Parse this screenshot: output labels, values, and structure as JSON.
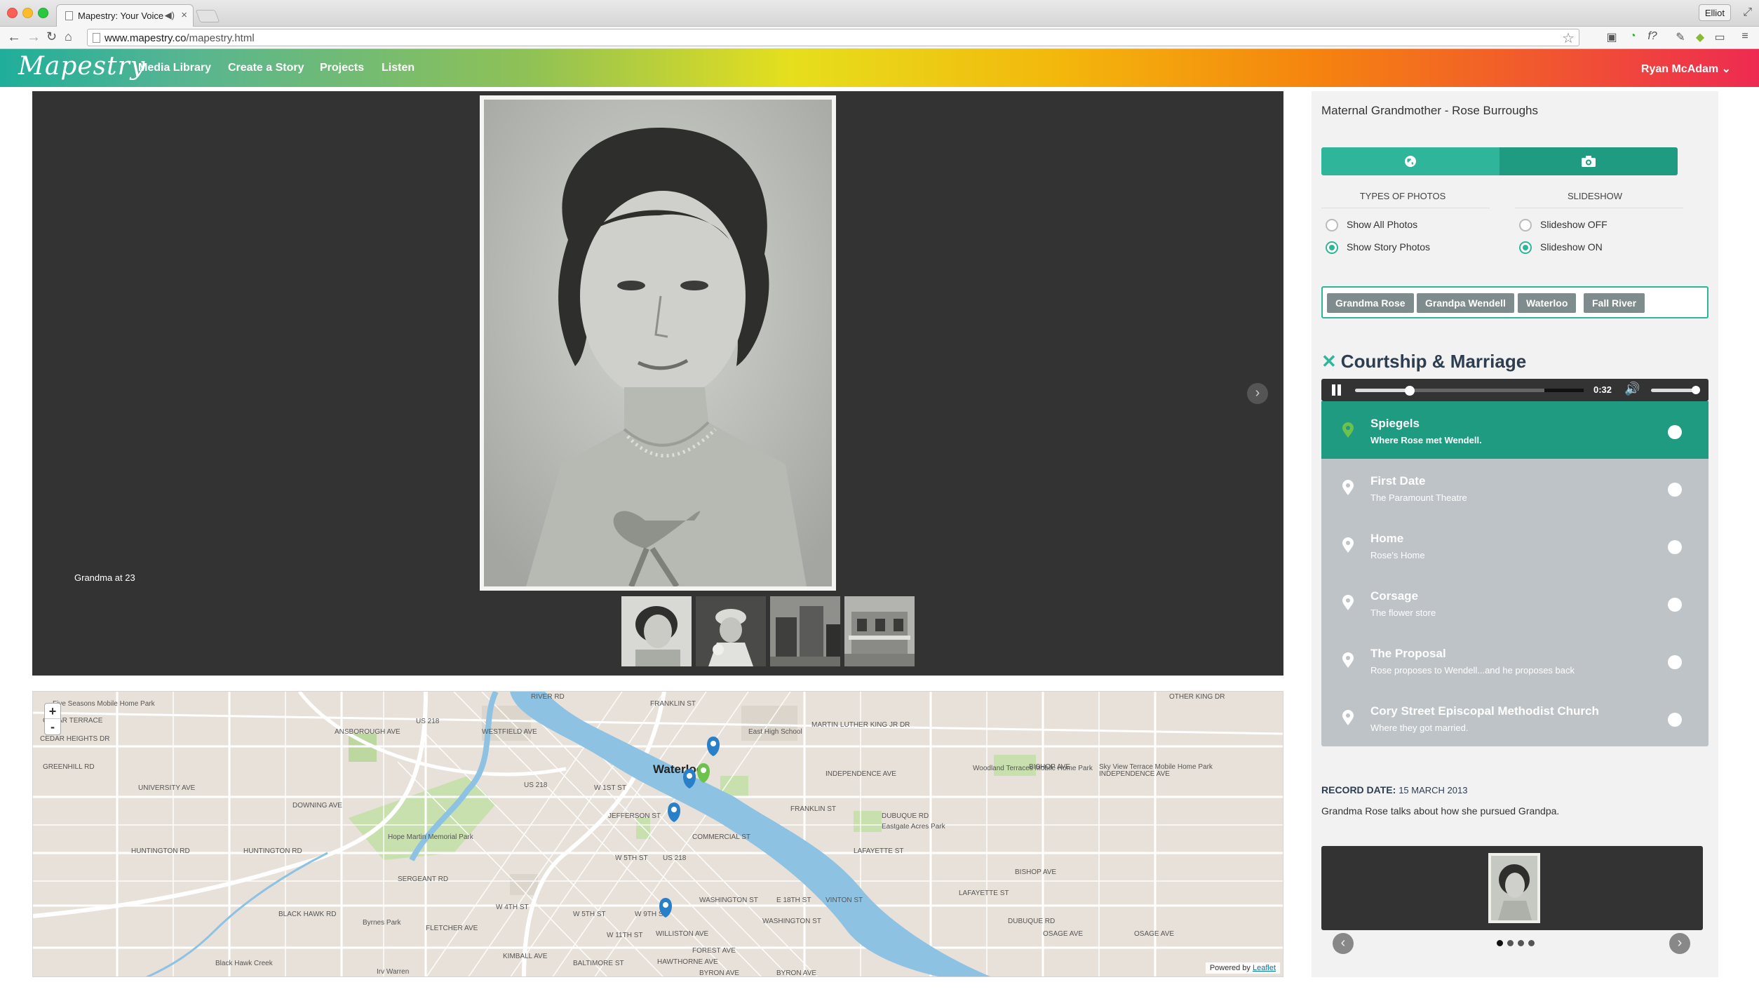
{
  "browser": {
    "tab_title": "Mapestry: Your Voice M",
    "url_host": "www.mapestry.co",
    "url_path": "/mapestry.html",
    "profile": "Elliot"
  },
  "app": {
    "logo": "Mapestry",
    "nav": [
      "Media Library",
      "Create a Story",
      "Projects",
      "Listen"
    ],
    "user": "Ryan McAdam"
  },
  "viewer": {
    "caption": "Grandma at 23",
    "thumbnails": [
      "grandma-portrait",
      "bride-portrait",
      "downtown-buildings",
      "house"
    ]
  },
  "map": {
    "zoom_in": "+",
    "zoom_out": "-",
    "attribution_prefix": "Powered by",
    "attribution_link": "Leaflet",
    "labels": {
      "city": "Waterloo",
      "east_high": "East High School",
      "us218a": "US 218",
      "us218b": "US 218",
      "us218c": "US 218",
      "martin_luther": "MARTIN LUTHER KING JR DR",
      "independence": "INDEPENDENCE AVE",
      "independence2": "INDEPENDENCE AVE",
      "franklin": "FRANKLIN ST",
      "franklin2": "FRANKLIN ST",
      "greenhill": "GREENHILL RD",
      "university": "UNIVERSITY AVE",
      "downing": "DOWNING AVE",
      "huntington": "HUNTINGTON RD",
      "huntington2": "HUNTINGTON RD",
      "blackhawk": "BLACK HAWK RD",
      "blackhawk_creek": "Black Hawk Creek",
      "hope_martin": "Hope Martin Memorial Park",
      "byrnes": "Byrnes Park",
      "irv_warren": "Irv Warren",
      "williston": "WILLISTON AVE",
      "forest": "FOREST AVE",
      "hawthorne": "HAWTHORNE AVE",
      "byron": "BYRON AVE",
      "byron2": "BYRON AVE",
      "osage": "OSAGE AVE",
      "osage2": "OSAGE AVE",
      "cedar_terrace": "CEDAR TERRACE",
      "five_seasons": "Five Seasons Mobile Home Park",
      "woodland": "Woodland Terraces Mobile Home Park",
      "skyview": "Sky View Terrace Mobile Home Park",
      "eastgate": "Eastgate Acres Park",
      "lafayette": "LAFAYETTE ST",
      "lafayette2": "LAFAYETTE ST",
      "dubuque": "DUBUQUE RD",
      "dubuque2": "DUBUQUE RD",
      "washington": "WASHINGTON ST",
      "washington2": "WASHINGTON ST",
      "commercial": "COMMERCIAL ST",
      "jefferson": "JEFFERSON ST",
      "w5th": "W 5TH ST",
      "w4th": "W 4TH ST",
      "w9th": "W 9TH ST",
      "e18th": "E 18TH ST",
      "westfield": "WESTFIELD AVE",
      "ansborough": "ANSBOROUGH AVE",
      "fletcher": "FLETCHER AVE",
      "sergeant": "SERGEANT RD",
      "kimball": "KIMBALL AVE",
      "baltimore": "BALTIMORE ST",
      "w11th": "W 11TH ST",
      "bishop": "BISHOP AVE",
      "bishop2": "BISHOP AVE",
      "vinton": "VINTON ST",
      "river_rd": "RIVER RD",
      "other_king": "OTHER KING DR",
      "cedar_heights": "CEDAR HEIGHTS DR",
      "w1st": "W 1ST ST",
      "westloop": "W 5TH ST"
    }
  },
  "panel": {
    "title": "Maternal Grandmother - Rose Burroughs",
    "types_heading": "TYPES OF PHOTOS",
    "slideshow_heading": "SLIDESHOW",
    "show_all": "Show All Photos",
    "show_story": "Show Story Photos",
    "slideshow_off": "Slideshow OFF",
    "slideshow_on": "Slideshow ON",
    "tags": [
      "Grandma Rose",
      "Grandpa Wendell",
      "Waterloo",
      "Fall River"
    ],
    "story_title": "Courtship & Marriage",
    "player_time": "0:32",
    "progress_fraction": 0.24,
    "volume_fraction": 1.0,
    "stops": [
      {
        "title": "Spiegels",
        "subtitle": "Where Rose met Wendell."
      },
      {
        "title": "First Date",
        "subtitle": "The Paramount Theatre"
      },
      {
        "title": "Home",
        "subtitle": "Rose's Home"
      },
      {
        "title": "Corsage",
        "subtitle": "The flower store"
      },
      {
        "title": "The Proposal",
        "subtitle": "Rose proposes to Wendell...and he proposes back"
      },
      {
        "title": "Cory Street Episcopal Methodist Church",
        "subtitle": "Where they got married."
      }
    ],
    "record_label": "RECORD DATE:",
    "record_date": "15 MARCH 2013",
    "description": "Grandma Rose talks about how she pursued Grandpa.",
    "pager_count": 4,
    "pager_active": 0
  },
  "colors": {
    "accent": "#2fb59a",
    "accent_dark": "#1e9b80",
    "pin_blue": "#2a7fc9",
    "pin_green": "#6cc24a",
    "viewer_bg": "#333333"
  }
}
